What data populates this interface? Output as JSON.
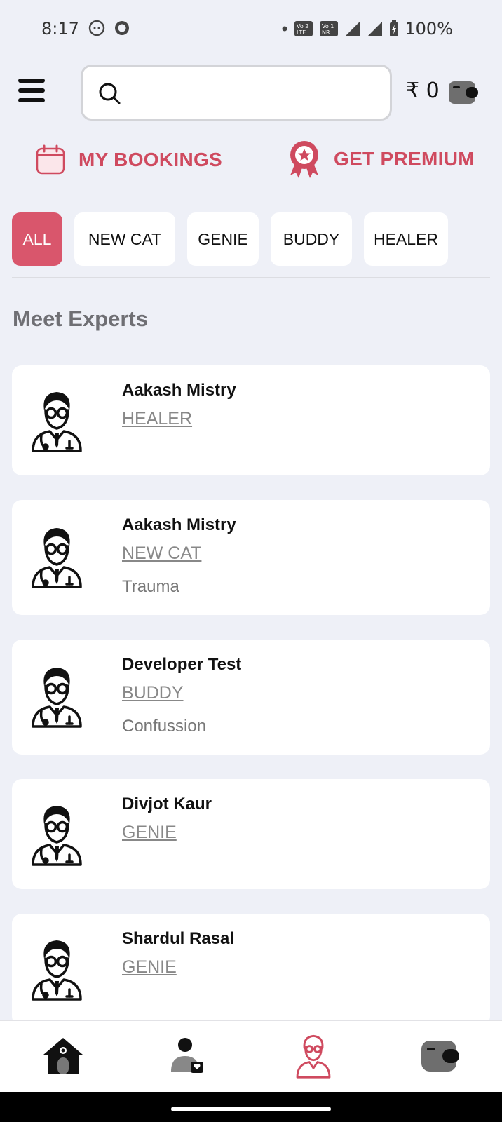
{
  "status_bar": {
    "time": "8:17",
    "battery": "100%",
    "icons": [
      "cat-face-icon",
      "circle-icon",
      "dot-icon",
      "volte-2-icon",
      "vonr-1-icon",
      "signal-icon",
      "signal-icon",
      "battery-charging-icon"
    ]
  },
  "header": {
    "menu_icon": "hamburger-menu-icon",
    "search_placeholder": "",
    "search_icon": "search-icon",
    "wallet_amount": "₹ 0",
    "wallet_icon": "wallet-icon"
  },
  "actions": {
    "bookings_label": "MY BOOKINGS",
    "premium_label": "GET PREMIUM",
    "accent": "#cf4a5f"
  },
  "filters": {
    "chips": [
      "ALL",
      "NEW CAT",
      "GENIE",
      "BUDDY",
      "HEALER"
    ],
    "selected": "ALL",
    "selected_color": "#d9566c"
  },
  "section_title": "Meet Experts",
  "experts": [
    {
      "name": "Aakash Mistry",
      "category": "HEALER",
      "issue": ""
    },
    {
      "name": "Aakash Mistry",
      "category": "NEW CAT",
      "issue": "Trauma"
    },
    {
      "name": "Developer  Test",
      "category": "BUDDY",
      "issue": "Confussion"
    },
    {
      "name": "Divjot Kaur",
      "category": "GENIE",
      "issue": ""
    },
    {
      "name": "Shardul Rasal",
      "category": "GENIE",
      "issue": ""
    }
  ],
  "bottom_nav": {
    "items": [
      "home-icon",
      "profile-icon",
      "expert-icon",
      "wallet-icon"
    ],
    "active": "expert-icon"
  }
}
